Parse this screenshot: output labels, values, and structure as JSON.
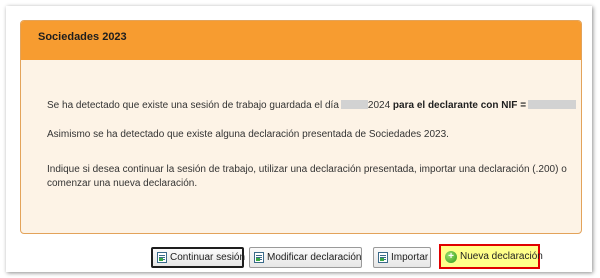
{
  "panel": {
    "title": "Sociedades 2023",
    "p1": {
      "text_a": "Se ha detectado que existe una sesión de trabajo guardada el día",
      "year": "2024",
      "text_b": "para el declarante con NIF ="
    },
    "p2": "Asimismo se ha detectado que existe alguna declaración presentada de Sociedades 2023.",
    "p3": "Indique si desea continuar la sesión de trabajo, utilizar una declaración presentada, importar una declaración (.200) o comenzar una nueva declaración."
  },
  "buttons": {
    "continuar": "Continuar sesión",
    "modificar": "Modificar declaración",
    "importar": "Importar",
    "nueva": "Nueva declaración"
  },
  "icons": {
    "continuar": "document-icon",
    "modificar": "document-icon",
    "importar": "document-icon",
    "nueva": "plus-circle-icon"
  },
  "colors": {
    "header": "#f79c30",
    "panel_bg": "#fdf3e6",
    "highlight_border": "#e00000",
    "highlight_bg": "#ffff8a"
  }
}
